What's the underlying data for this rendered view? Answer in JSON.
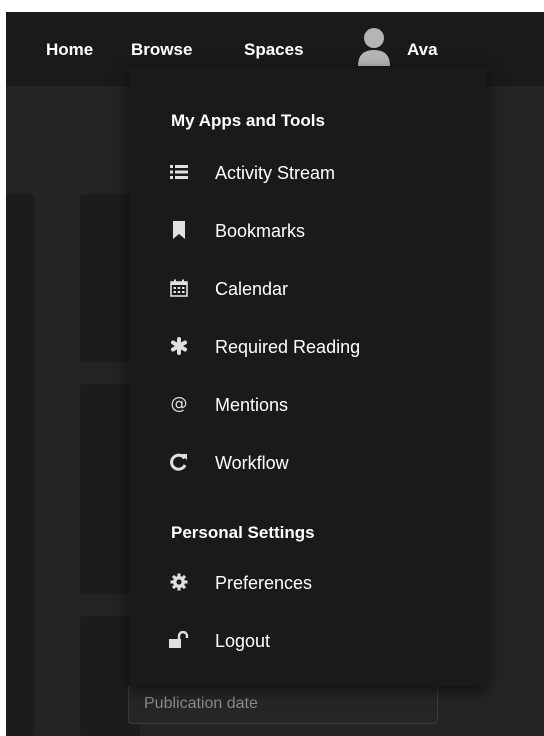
{
  "nav": {
    "home": "Home",
    "browse": "Browse",
    "spaces": "Spaces",
    "user_name": "Ava"
  },
  "dropdown": {
    "section_apps": "My Apps and Tools",
    "apps_items": [
      {
        "label": "Activity Stream",
        "icon": "list-icon"
      },
      {
        "label": "Bookmarks",
        "icon": "bookmark-icon"
      },
      {
        "label": "Calendar",
        "icon": "calendar-icon"
      },
      {
        "label": "Required Reading",
        "icon": "asterisk-icon"
      },
      {
        "label": "Mentions",
        "icon": "at-icon"
      },
      {
        "label": "Workflow",
        "icon": "refresh-icon"
      }
    ],
    "section_settings": "Personal Settings",
    "settings_items": [
      {
        "label": "Preferences",
        "icon": "gear-icon"
      },
      {
        "label": "Logout",
        "icon": "unlock-icon"
      }
    ]
  },
  "form": {
    "publication_date_placeholder": "Publication date"
  },
  "colors": {
    "page_bg": "#242424",
    "topbar_bg": "#1a1a1a",
    "menu_bg": "#1a1a1a",
    "text": "#ffffff"
  }
}
